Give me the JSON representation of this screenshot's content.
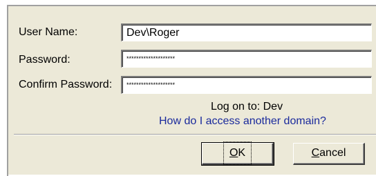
{
  "form": {
    "username_label": "User Name:",
    "username_value": "Dev\\Roger",
    "password_label": "Password:",
    "password_mask": "********************",
    "confirm_label": "Confirm Password:",
    "confirm_mask": "********************"
  },
  "logon": {
    "text": "Log on to: Dev",
    "domain_link": "How do I access another domain?"
  },
  "buttons": {
    "ok_mnemonic": "O",
    "ok_rest": "K",
    "cancel_mnemonic": "C",
    "cancel_rest": "ancel"
  },
  "colors": {
    "dialog_background": "#ece9d8",
    "link": "#1a2a9c"
  }
}
